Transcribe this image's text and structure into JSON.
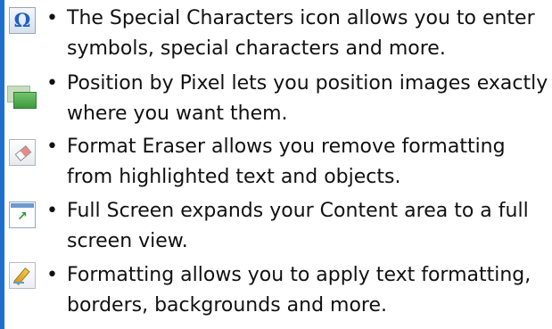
{
  "accent_color": "#1e6fd0",
  "features": [
    {
      "icon": "special-characters-icon",
      "text": "The Special Characters icon allows you to enter symbols, special characters and more."
    },
    {
      "icon": "position-by-pixel-icon",
      "text": "Position by Pixel lets you position images exactly where you want them."
    },
    {
      "icon": "format-eraser-icon",
      "text": "Format Eraser allows you remove formatting from highlighted text and objects."
    },
    {
      "icon": "full-screen-icon",
      "text": "Full Screen expands your Content area to a full screen view."
    },
    {
      "icon": "formatting-icon",
      "text": "Formatting allows you to apply text formatting, borders, backgrounds and more."
    }
  ],
  "bullet": "•",
  "omega_glyph": "Ω"
}
